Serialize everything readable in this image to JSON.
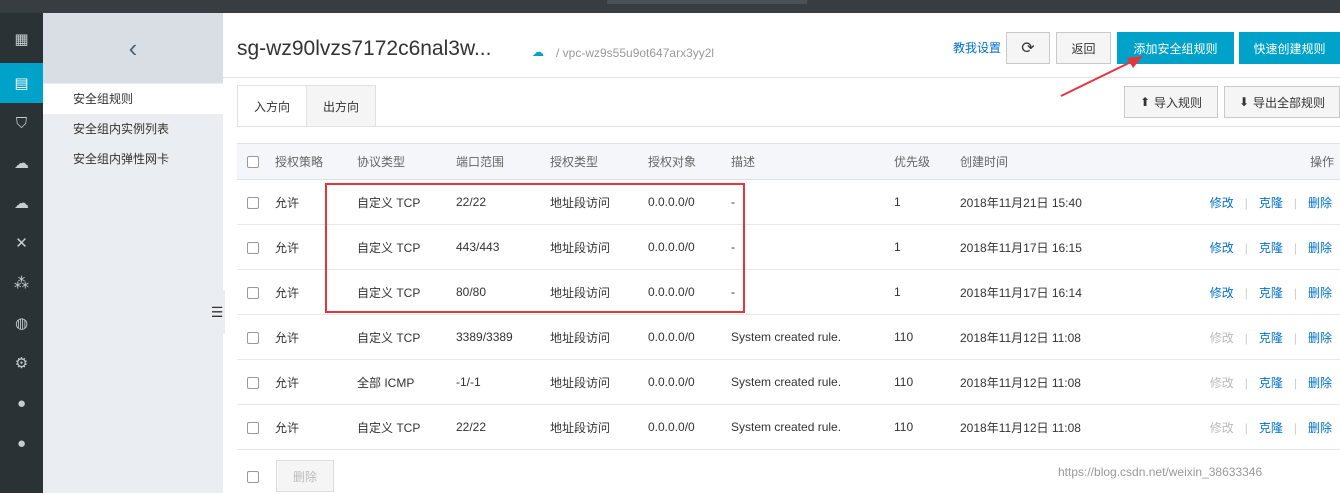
{
  "leftnav": {
    "icons": [
      "grid-icon",
      "server-icon",
      "shield-icon",
      "cloud-icon",
      "cloud-upload-icon",
      "shuffle-icon",
      "network-icon",
      "globe-icon",
      "gear-icon",
      "dot-icon",
      "dot-icon"
    ]
  },
  "subnav": {
    "back_glyph": "‹",
    "items": [
      {
        "label": "安全组规则"
      },
      {
        "label": "安全组内实例列表"
      },
      {
        "label": "安全组内弹性网卡"
      }
    ]
  },
  "header": {
    "title": "sg-wz90lvzs7172c6nal3w...",
    "vpc": "/ vpc-wz9s55u9ot647arx3yy2l",
    "teach_link": "教我设置",
    "refresh_glyph": "⟳",
    "back_button": "返回",
    "add_rule_button": "添加安全组规则",
    "quick_create_button": "快速创建规则"
  },
  "tabs": [
    {
      "label": "入方向"
    },
    {
      "label": "出方向"
    }
  ],
  "toolbar": {
    "import_label": "导入规则",
    "export_label": "导出全部规则"
  },
  "table": {
    "columns": [
      "授权策略",
      "协议类型",
      "端口范围",
      "授权类型",
      "授权对象",
      "描述",
      "优先级",
      "创建时间",
      "操作"
    ],
    "rows": [
      {
        "policy": "允许",
        "protocol": "自定义 TCP",
        "port": "22/22",
        "auth_type": "地址段访问",
        "auth_obj": "0.0.0.0/0",
        "desc": "-",
        "priority": "1",
        "created": "2018年11月21日 15:40",
        "edit": "修改",
        "edit_enabled": true,
        "clone": "克隆",
        "delete": "删除"
      },
      {
        "policy": "允许",
        "protocol": "自定义 TCP",
        "port": "443/443",
        "auth_type": "地址段访问",
        "auth_obj": "0.0.0.0/0",
        "desc": "-",
        "priority": "1",
        "created": "2018年11月17日 16:15",
        "edit": "修改",
        "edit_enabled": true,
        "clone": "克隆",
        "delete": "删除"
      },
      {
        "policy": "允许",
        "protocol": "自定义 TCP",
        "port": "80/80",
        "auth_type": "地址段访问",
        "auth_obj": "0.0.0.0/0",
        "desc": "-",
        "priority": "1",
        "created": "2018年11月17日 16:14",
        "edit": "修改",
        "edit_enabled": true,
        "clone": "克隆",
        "delete": "删除"
      },
      {
        "policy": "允许",
        "protocol": "自定义 TCP",
        "port": "3389/3389",
        "auth_type": "地址段访问",
        "auth_obj": "0.0.0.0/0",
        "desc": "System created rule.",
        "priority": "110",
        "created": "2018年11月12日 11:08",
        "edit": "修改",
        "edit_enabled": false,
        "clone": "克隆",
        "delete": "删除"
      },
      {
        "policy": "允许",
        "protocol": "全部 ICMP",
        "port": "-1/-1",
        "auth_type": "地址段访问",
        "auth_obj": "0.0.0.0/0",
        "desc": "System created rule.",
        "priority": "110",
        "created": "2018年11月12日 11:08",
        "edit": "修改",
        "edit_enabled": false,
        "clone": "克隆",
        "delete": "删除"
      },
      {
        "policy": "允许",
        "protocol": "自定义 TCP",
        "port": "22/22",
        "auth_type": "地址段访问",
        "auth_obj": "0.0.0.0/0",
        "desc": "System created rule.",
        "priority": "110",
        "created": "2018年11月12日 11:08",
        "edit": "修改",
        "edit_enabled": false,
        "clone": "克隆",
        "delete": "删除"
      }
    ]
  },
  "footer": {
    "delete_button": "删除"
  },
  "watermark": "https://blog.csdn.net/weixin_38633346",
  "colors": {
    "primary": "#00a2ca",
    "link": "#0070cc",
    "highlight": "#e5353b",
    "nav_bg": "#2b3236"
  }
}
